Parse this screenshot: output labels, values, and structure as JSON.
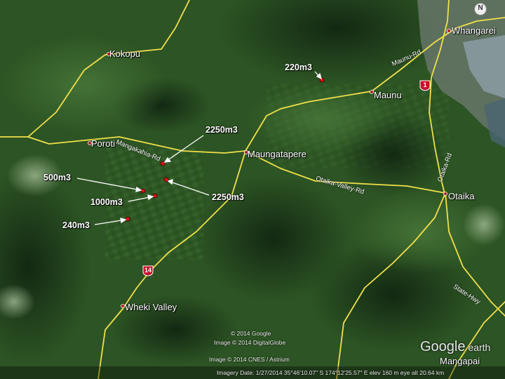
{
  "towns": {
    "whangarei": "Whangarei",
    "kokopu": "Kokopu",
    "maunu": "Maunu",
    "poroti": "Poroti",
    "maungatapere": "Maungatapere",
    "otaika": "Otaika",
    "wheki_valley": "Wheki Valley",
    "mangapai": "Mangapai"
  },
  "roads": {
    "mangakahia": "Mangakahia-Rd",
    "maunu": "Maunu-Rd",
    "otaika_valley": "Otaika-Valley-Rd",
    "otaika_road": "Otaika-Rd",
    "state_hwy": "State-Hwy"
  },
  "shields": {
    "sh1": "1",
    "sh14": "14"
  },
  "volumes": {
    "v220": "220m3",
    "v2250a": "2250m3",
    "v500": "500m3",
    "v1000": "1000m3",
    "v2250b": "2250m3",
    "v240": "240m3"
  },
  "credits": {
    "google": "© 2014 Google",
    "digitalglobe": "Image © 2014 DigitalGlobe",
    "cnes": "Image © 2014 CNES / Astrium",
    "status": "Imagery Date: 1/27/2014      35°46'10.07\" S  174°12'25.57\" E  elev  160 m     eye alt  20.64 km"
  },
  "logo": {
    "google": "Google",
    "earth": " earth"
  },
  "compass": "N",
  "colors": {
    "road": "#f0e04a",
    "marker": "#e01010",
    "shield": "#c8102e"
  }
}
